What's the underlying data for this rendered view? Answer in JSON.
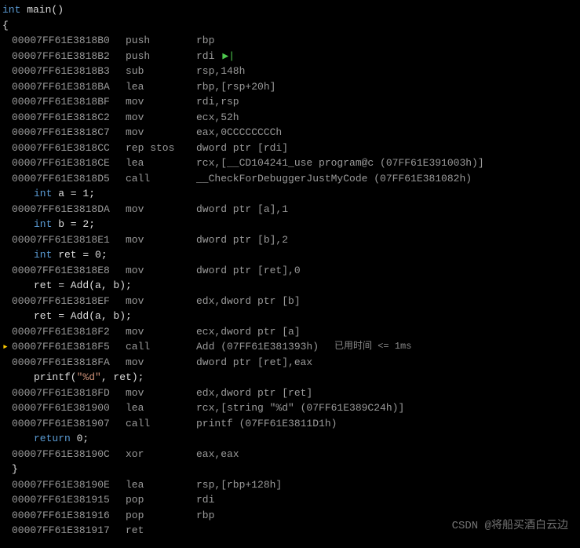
{
  "header": {
    "sig": "int main()",
    "brace": "{"
  },
  "lines": [
    {
      "addr": "00007FF61E3818B0",
      "op": "push",
      "args": "rbp"
    },
    {
      "addr": "00007FF61E3818B2",
      "op": "push",
      "args": "rdi",
      "cursor": true
    },
    {
      "addr": "00007FF61E3818B3",
      "op": "sub",
      "args": "rsp,148h"
    },
    {
      "addr": "00007FF61E3818BA",
      "op": "lea",
      "args": "rbp,[rsp+20h]"
    },
    {
      "addr": "00007FF61E3818BF",
      "op": "mov",
      "args": "rdi,rsp"
    },
    {
      "addr": "00007FF61E3818C2",
      "op": "mov",
      "args": "ecx,52h"
    },
    {
      "addr": "00007FF61E3818C7",
      "op": "mov",
      "args": "eax,0CCCCCCCCh"
    },
    {
      "addr": "00007FF61E3818CC",
      "op": "rep stos",
      "args": "dword ptr [rdi]"
    },
    {
      "addr": "00007FF61E3818CE",
      "op": "lea",
      "args": "rcx,[__CD104241_use program@c (07FF61E391003h)]"
    },
    {
      "addr": "00007FF61E3818D5",
      "op": "call",
      "args": "__CheckForDebuggerJustMyCode (07FF61E381082h)"
    },
    {
      "src": "int a = 1;",
      "kind": "decl"
    },
    {
      "addr": "00007FF61E3818DA",
      "op": "mov",
      "args": "dword ptr [a],1"
    },
    {
      "src": "int b = 2;",
      "kind": "decl"
    },
    {
      "addr": "00007FF61E3818E1",
      "op": "mov",
      "args": "dword ptr [b],2"
    },
    {
      "src": "int ret = 0;",
      "kind": "decl"
    },
    {
      "addr": "00007FF61E3818E8",
      "op": "mov",
      "args": "dword ptr [ret],0"
    },
    {
      "src": "ret = Add(a, b);",
      "kind": "stmt"
    },
    {
      "addr": "00007FF61E3818EF",
      "op": "mov",
      "args": "edx,dword ptr [b]"
    },
    {
      "src": "ret = Add(a, b);",
      "kind": "stmt"
    },
    {
      "addr": "00007FF61E3818F2",
      "op": "mov",
      "args": "ecx,dword ptr [a]"
    },
    {
      "addr": "00007FF61E3818F5",
      "op": "call",
      "args": "Add (07FF61E381393h)",
      "timing": "已用时间 <= 1ms",
      "marker": true
    },
    {
      "addr": "00007FF61E3818FA",
      "op": "mov",
      "args": "dword ptr [ret],eax"
    },
    {
      "src": "printf(\"%d\", ret);",
      "kind": "printf"
    },
    {
      "addr": "00007FF61E3818FD",
      "op": "mov",
      "args": "edx,dword ptr [ret]"
    },
    {
      "addr": "00007FF61E381900",
      "op": "lea",
      "args": "rcx,[string \"%d\" (07FF61E389C24h)]"
    },
    {
      "addr": "00007FF61E381907",
      "op": "call",
      "args": "printf (07FF61E3811D1h)"
    },
    {
      "src": "return 0;",
      "kind": "ret"
    },
    {
      "addr": "00007FF61E38190C",
      "op": "xor",
      "args": "eax,eax"
    },
    {
      "src": "}",
      "kind": "brace"
    },
    {
      "addr": "00007FF61E38190E",
      "op": "lea",
      "args": "rsp,[rbp+128h]"
    },
    {
      "addr": "00007FF61E381915",
      "op": "pop",
      "args": "rdi"
    },
    {
      "addr": "00007FF61E381916",
      "op": "pop",
      "args": "rbp"
    },
    {
      "addr": "00007FF61E381917",
      "op": "ret",
      "args": ""
    }
  ],
  "watermark": "CSDN @将船买酒白云边"
}
